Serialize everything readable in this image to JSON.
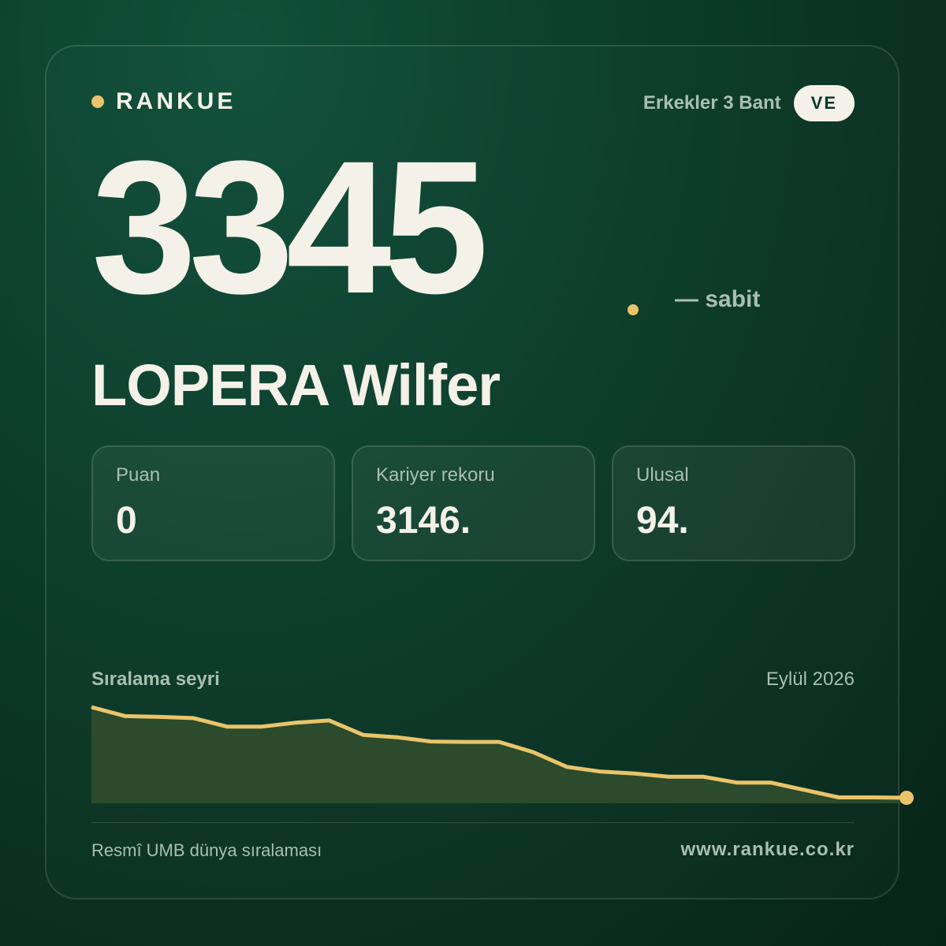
{
  "brand": {
    "name": "RANKUE"
  },
  "category": {
    "label": "Erkekler 3 Bant",
    "badge": "VE"
  },
  "rank": {
    "value": "3345",
    "trend": "— sabit"
  },
  "player": {
    "name": "LOPERA Wilfer"
  },
  "stats": [
    {
      "label": "Puan",
      "value": "0"
    },
    {
      "label": "Kariyer rekoru",
      "value": "3146."
    },
    {
      "label": "Ulusal",
      "value": "94."
    }
  ],
  "chart": {
    "title": "Sıralama seyri",
    "date": "Eylül 2026"
  },
  "chart_data": {
    "type": "area",
    "values": [
      3052,
      3075,
      3077,
      3080,
      3102,
      3102,
      3092,
      3086,
      3123,
      3129,
      3140,
      3141,
      3141,
      3167,
      3205,
      3217,
      3222,
      3230,
      3230,
      3245,
      3245,
      3264,
      3283,
      3283,
      3284
    ],
    "y_inverted": true,
    "grid": false,
    "colors": {
      "line": "#e9c46a",
      "fill": "#2c4a2c"
    }
  },
  "footer": {
    "source": "Resmî UMB dünya sıralaması",
    "url": "www.rankue.co.kr"
  },
  "colors": {
    "accent": "#e9c46a",
    "background": "#0b3a28",
    "text": "#f4f1e8",
    "muted": "#a9bfb0"
  }
}
